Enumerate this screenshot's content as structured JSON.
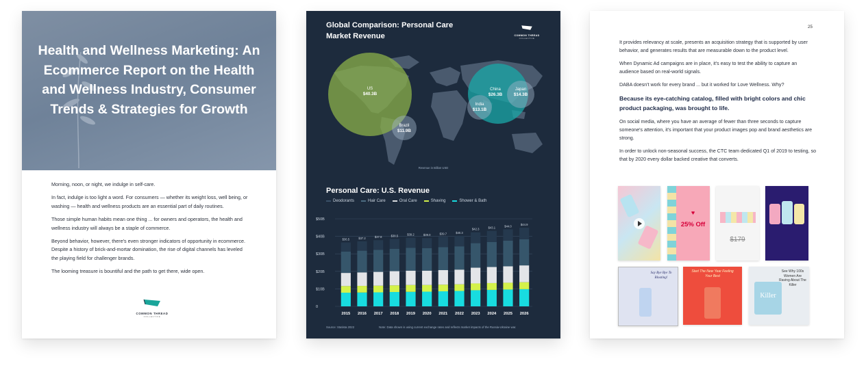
{
  "page1": {
    "title": "Health and Wellness Marketing: An Ecommerce Report on the Health and Wellness Industry, Consumer Trends & Strategies for Growth",
    "paragraphs": [
      "Morning, noon, or night, we indulge in self-care.",
      "In fact, indulge is too light a word. For consumers — whether its weight loss, well being, or washing — health and wellness products are an essential part of daily routines.",
      "Those simple human habits mean one thing ... for owners and operators, the health and wellness industry will always be a staple of commerce.",
      "Beyond behavior, however, there's even stronger indicators of opportunity in ecommerce. Despite a history of brick-and-mortar domination, the rise of digital channels has leveled the playing field for challenger brands.",
      "The looming treasure is bountiful and the path to get there, wide open."
    ],
    "logo_text": "COMMON THREAD",
    "logo_sub": "COLLECTIVE"
  },
  "page2": {
    "title": "Global Comparison: Personal Care Market Revenue",
    "logo_text": "COMMON THREAD",
    "logo_sub": "COLLECTIVE",
    "map_note": "Revenue in Billion USD",
    "bubbles": [
      {
        "name": "US",
        "value": "$40.3B"
      },
      {
        "name": "China",
        "value": "$26.3B"
      },
      {
        "name": "Japan",
        "value": "$14.3B"
      },
      {
        "name": "India",
        "value": "$13.1B"
      },
      {
        "name": "Brazil",
        "value": "$11.9B"
      }
    ],
    "subtitle": "Personal Care: U.S. Revenue",
    "source": "Source: Statista 2022",
    "note": "Note: Data shown is using current exchange rates and reflects market impacts of the Russia-Ukraine war.",
    "colors": {
      "background": "#1d2b3d",
      "deodorants": "#1f3447",
      "hair": "#36566b",
      "oral": "#d9dbdf",
      "shaving": "#d4f24b",
      "shower": "#18dce0",
      "us_bubble": "#8bb04a",
      "asia_bubble": "#1aa8a8"
    }
  },
  "chart_data": {
    "type": "bar",
    "title": "Personal Care: U.S. Revenue",
    "stacked": true,
    "categories": [
      "2015",
      "2016",
      "2017",
      "2018",
      "2019",
      "2020",
      "2021",
      "2022",
      "2023",
      "2024",
      "2025",
      "2026"
    ],
    "totals_labels": [
      "$36.5",
      "$37.2",
      "$37.8",
      "$38.5",
      "$39.2",
      "$39.0",
      "$39.7",
      "$40.3",
      "$42.3",
      "$43.1",
      "$44.0",
      "$44.9"
    ],
    "totals": [
      36.5,
      37.2,
      37.8,
      38.5,
      39.2,
      39.0,
      39.7,
      40.3,
      42.3,
      43.1,
      44.0,
      44.9
    ],
    "yticks": [
      "0",
      "$10B",
      "$20B",
      "$30B",
      "$40B",
      "$50B"
    ],
    "ylim": [
      0,
      50
    ],
    "legend_position": "top-left",
    "series": [
      {
        "name": "Shower & Bath",
        "values": [
          7.8,
          7.9,
          8.0,
          8.2,
          8.3,
          8.4,
          8.6,
          8.8,
          9.2,
          9.4,
          9.6,
          9.8
        ]
      },
      {
        "name": "Shaving",
        "values": [
          3.8,
          3.8,
          3.8,
          3.8,
          3.9,
          3.8,
          3.8,
          3.8,
          3.9,
          3.9,
          3.9,
          4.0
        ]
      },
      {
        "name": "Oral Care",
        "values": [
          7.5,
          7.7,
          7.9,
          8.1,
          8.2,
          8.2,
          8.3,
          8.4,
          9.0,
          9.2,
          9.4,
          9.6
        ]
      },
      {
        "name": "Hair Care",
        "values": [
          12.2,
          12.4,
          12.6,
          12.8,
          13.0,
          12.9,
          13.1,
          13.3,
          14.0,
          14.3,
          14.6,
          14.9
        ]
      },
      {
        "name": "Deodorants",
        "values": [
          5.2,
          5.4,
          5.5,
          5.6,
          5.8,
          5.7,
          5.9,
          6.0,
          6.2,
          6.3,
          6.5,
          6.6
        ]
      }
    ],
    "legend": [
      "Deodorants",
      "Hair Care",
      "Oral Care",
      "Shaving",
      "Shower & Bath"
    ]
  },
  "page3": {
    "page_number": "25",
    "paragraphs_top": [
      "It provides relevancy at scale, presents an acquisition strategy that is supported by user behavior, and generates results that are measurable down to the product level.",
      "When Dynamic Ad campaigns are in place, it's easy to test the ability to capture an audience based on real-world signals.",
      "DABA doesn't work for every brand ... but it worked for Love Wellness. Why?"
    ],
    "highlight": "Because its eye-catching catalog, filled with bright colors and chic product packaging, was brought to life.",
    "paragraphs_bottom": [
      "On social media, where you have an average of fewer than three seconds to capture someone's attention, it's important that your product images pop and brand aesthetics are strong.",
      "In order to unlock non-seasonal success, the CTC team dedicated Q1 of 2019 to testing, so that by 2020 every dollar backed creative that converts."
    ],
    "ads": {
      "off_text": "25% Off",
      "price": "$179",
      "bloating": "Say Bye Bye To Bloating!",
      "start": "Start The New Year Feeling Your Best",
      "killer": "Killer",
      "killer_tag": "See Why 100s Women Are Raving About The Killer"
    }
  }
}
